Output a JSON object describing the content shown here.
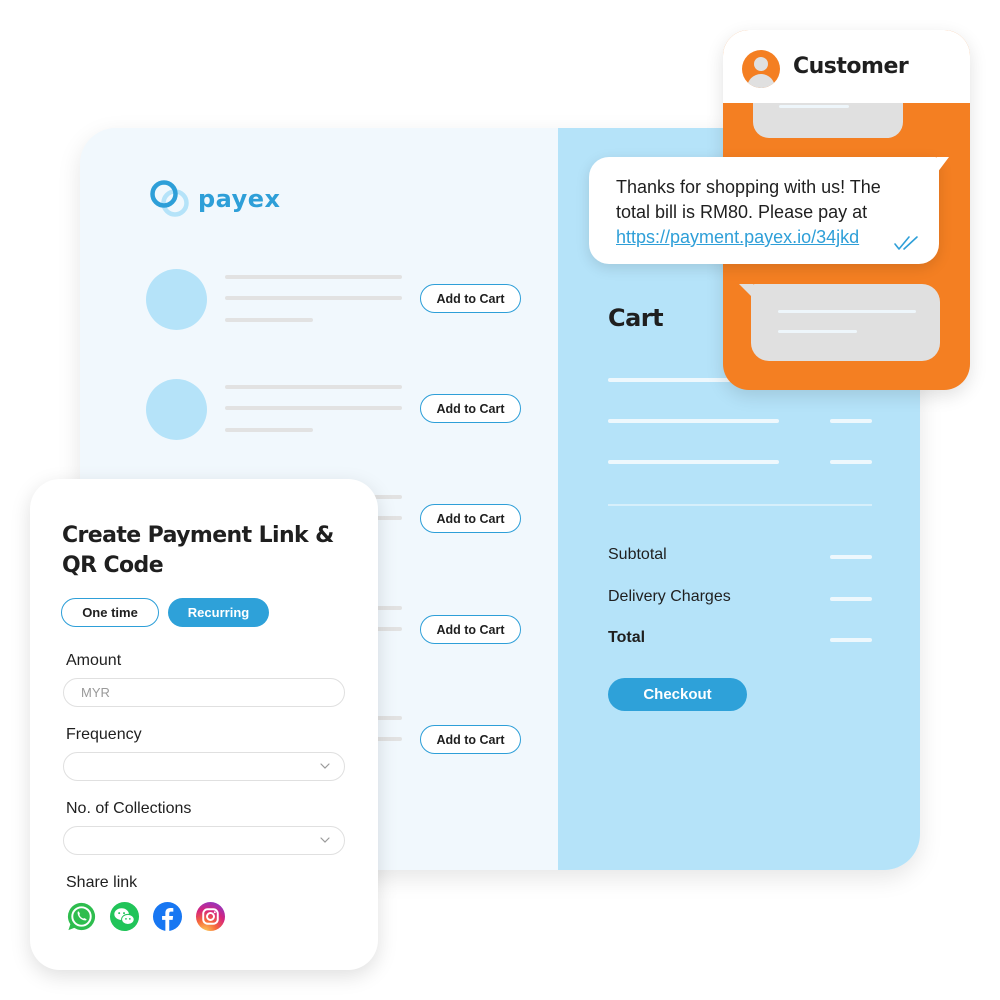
{
  "brand": {
    "name": "payex",
    "color": "#2e9fd8",
    "accent_orange": "#f47f22",
    "light_blue": "#b5e3f9"
  },
  "shop": {
    "products": [
      {
        "button_label": "Add to Cart"
      },
      {
        "button_label": "Add to Cart"
      },
      {
        "button_label": "Add to Cart"
      },
      {
        "button_label": "Add to Cart"
      },
      {
        "button_label": "Add to Cart"
      }
    ]
  },
  "cart": {
    "title": "Cart",
    "summary": [
      {
        "label": "Subtotal"
      },
      {
        "label": "Delivery Charges"
      },
      {
        "label": "Total"
      }
    ],
    "checkout_label": "Checkout"
  },
  "chat": {
    "contact_name": "Customer",
    "avatar_icon": "user-avatar-icon",
    "message": {
      "text": "Thanks for shopping with us! The total bill is RM80. Please pay at ",
      "link": "https://payment.payex.io/34jkd",
      "status_icon": "double-check-icon"
    }
  },
  "payment_form": {
    "title": "Create Payment Link & QR Code",
    "toggle": {
      "options": [
        "One time",
        "Recurring"
      ],
      "selected": "Recurring"
    },
    "amount": {
      "label": "Amount",
      "placeholder": "MYR",
      "value": ""
    },
    "frequency": {
      "label": "Frequency",
      "value": ""
    },
    "collections": {
      "label": "No. of Collections",
      "value": ""
    },
    "share": {
      "label": "Share link",
      "icons": [
        "whatsapp-icon",
        "wechat-icon",
        "facebook-icon",
        "instagram-icon"
      ]
    }
  }
}
